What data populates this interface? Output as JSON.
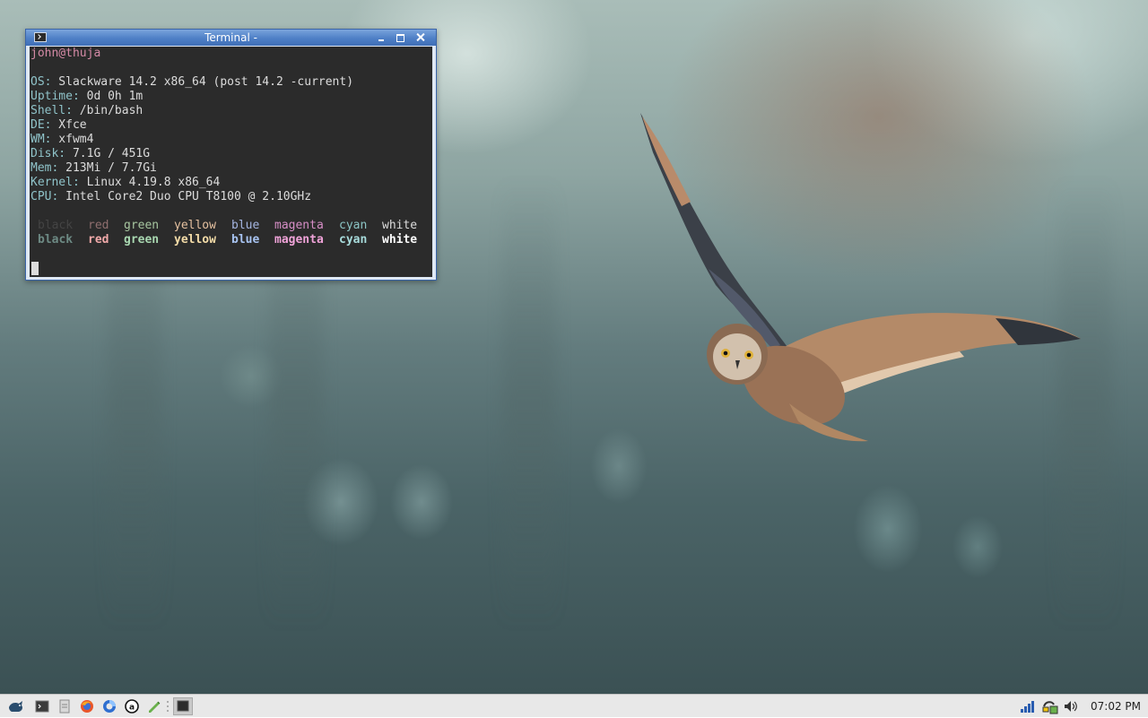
{
  "window": {
    "title": "Terminal -"
  },
  "terminal": {
    "user": "john@thuja",
    "info": [
      {
        "key": "OS:",
        "value": " Slackware 14.2 x86_64 (post 14.2 -current)"
      },
      {
        "key": "Uptime:",
        "value": " 0d 0h 1m"
      },
      {
        "key": "Shell:",
        "value": " /bin/bash"
      },
      {
        "key": "DE:",
        "value": " Xfce"
      },
      {
        "key": "WM:",
        "value": " xfwm4"
      },
      {
        "key": "Disk:",
        "value": " 7.1G / 451G"
      },
      {
        "key": "Mem:",
        "value": " 213Mi / 7.7Gi"
      },
      {
        "key": "Kernel:",
        "value": " Linux 4.19.8 x86_64"
      },
      {
        "key": "CPU:",
        "value": " Intel Core2 Duo CPU T8100 @ 2.10GHz"
      }
    ],
    "colors_normal": [
      "black",
      "red",
      "green",
      "yellow",
      "blue",
      "magenta",
      "cyan",
      "white"
    ],
    "colors_bold": [
      "black",
      "red",
      "green",
      "yellow",
      "blue",
      "magenta",
      "cyan",
      "white"
    ]
  },
  "taskbar": {
    "launchers": [
      "app-menu-icon",
      "terminal-icon",
      "file-manager-icon",
      "firefox-icon",
      "browser-icon",
      "text-editor-icon",
      "notes-icon"
    ],
    "clock": "07:02 PM"
  }
}
